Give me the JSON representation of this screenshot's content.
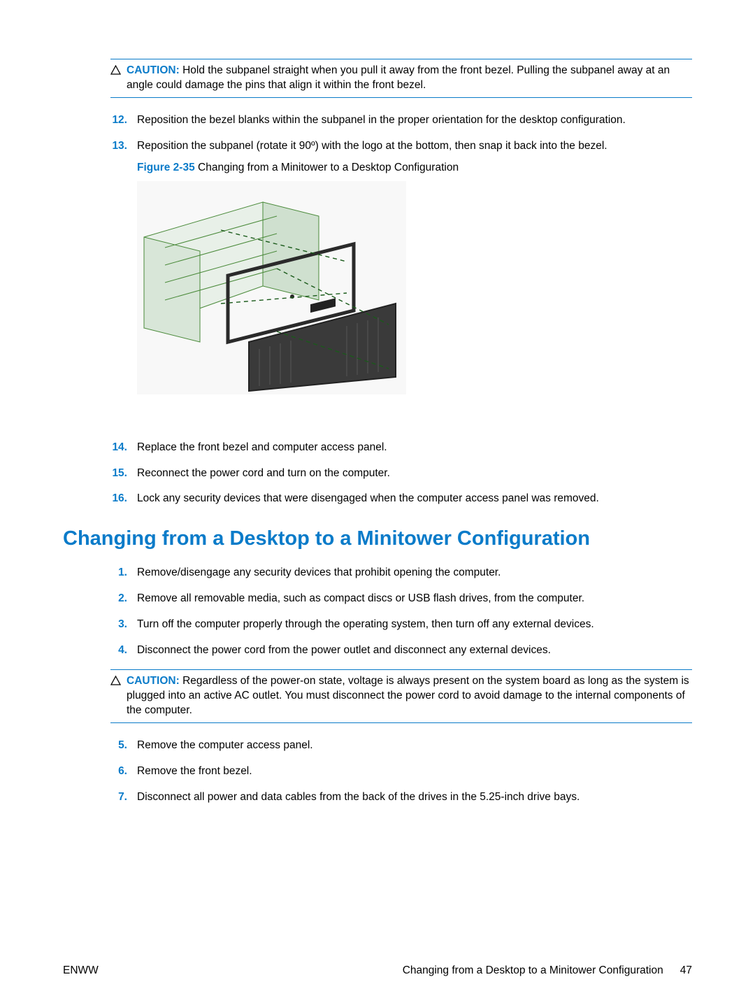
{
  "caution1": {
    "label": "CAUTION:",
    "text": "Hold the subpanel straight when you pull it away from the front bezel. Pulling the subpanel away at an angle could damage the pins that align it within the front bezel."
  },
  "steps_a": [
    {
      "num": "12.",
      "text": "Reposition the bezel blanks within the subpanel in the proper orientation for the desktop configuration."
    },
    {
      "num": "13.",
      "text": "Reposition the subpanel (rotate it 90º) with the logo at the bottom, then snap it back into the bezel."
    }
  ],
  "figure": {
    "label": "Figure 2-35",
    "caption": "Changing from a Minitower to a Desktop Configuration"
  },
  "steps_b": [
    {
      "num": "14.",
      "text": "Replace the front bezel and computer access panel."
    },
    {
      "num": "15.",
      "text": "Reconnect the power cord and turn on the computer."
    },
    {
      "num": "16.",
      "text": "Lock any security devices that were disengaged when the computer access panel was removed."
    }
  ],
  "heading": "Changing from a Desktop to a Minitower Configuration",
  "steps_c": [
    {
      "num": "1.",
      "text": "Remove/disengage any security devices that prohibit opening the computer."
    },
    {
      "num": "2.",
      "text": "Remove all removable media, such as compact discs or USB flash drives, from the computer."
    },
    {
      "num": "3.",
      "text": "Turn off the computer properly through the operating system, then turn off any external devices."
    },
    {
      "num": "4.",
      "text": "Disconnect the power cord from the power outlet and disconnect any external devices."
    }
  ],
  "caution2": {
    "label": "CAUTION:",
    "text": "Regardless of the power-on state, voltage is always present on the system board as long as the system is plugged into an active AC outlet. You must disconnect the power cord to avoid damage to the internal components of the computer."
  },
  "steps_d": [
    {
      "num": "5.",
      "text": "Remove the computer access panel."
    },
    {
      "num": "6.",
      "text": "Remove the front bezel."
    },
    {
      "num": "7.",
      "text": "Disconnect all power and data cables from the back of the drives in the 5.25-inch drive bays."
    }
  ],
  "footer": {
    "left": "ENWW",
    "right_title": "Changing from a Desktop to a Minitower Configuration",
    "page": "47"
  }
}
